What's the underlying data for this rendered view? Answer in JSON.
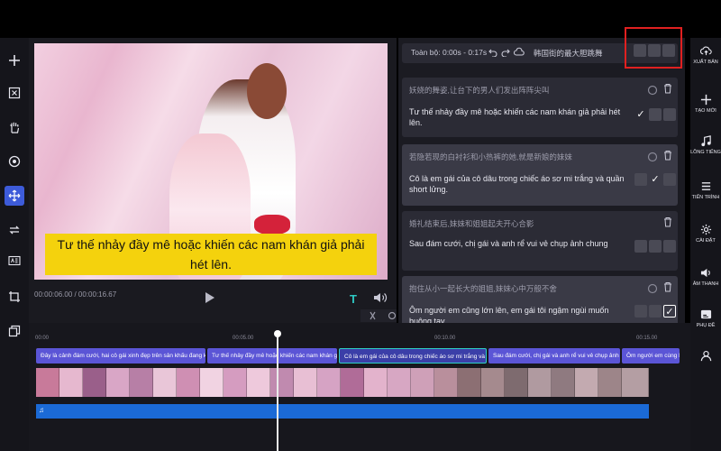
{
  "preview": {
    "caption": "Tư thế nhảy đầy mê hoặc khiến các nam khán giả phải hét lên.",
    "timecode": "00:00:06.00 / 00:00:16.67"
  },
  "panel": {
    "range_label": "Toàn bộ: 0:00s - 0:17s",
    "title": "韩国街的最大胆跳舞",
    "cards": [
      {
        "cn": "妖娆的舞姿,让台下的男人们发出阵阵尖叫",
        "vi": "Tư thế nhảy đầy mê hoặc khiến các nam khán giả phải hét lên."
      },
      {
        "cn": "若隐若现的白衬衫和小热裤的她,就是新娘的妹妹",
        "vi": "Cô là em gái của cô dâu trong chiếc áo sơ mi trắng và quần short lửng."
      },
      {
        "cn": "婚礼结束后,妹妹和姐姐起夫开心合影",
        "vi": "Sau đám cưới, chị gái và anh rể vui vẻ chụp ảnh chung"
      },
      {
        "cn": "抱住从小一起长大的姐姐,妹妹心中万般不舍",
        "vi": "Ôm người em cũng lớn lên, em gái tôi ngậm ngùi muốn buông tay"
      }
    ]
  },
  "right_rail": {
    "export": "XUẤT BẢN",
    "new": "TẠO MỚI",
    "voice": "LỒNG TIẾNG",
    "progress": "TIẾN TRÌNH",
    "settings": "CÀI ĐẶT",
    "audio": "ÂM THANH",
    "subtitle": "PHỤ ĐỀ"
  },
  "timeline": {
    "ticks": [
      "00:00",
      "00:05.00",
      "00:10.00",
      "00:15.00"
    ],
    "clips": [
      "Đây là cảnh đám cưới, hai cô gái xinh đẹp trên sân khấu đang k",
      "Tư thế nhảy đầy mê hoặc khiến các nam khán giả",
      "Cô là em gái của cô dâu trong chiếc áo sơ mi trắng và q",
      "Sau đám cưới, chị gái và anh rể vui vẻ chụp ảnh",
      "Ôm người em cùng lớn"
    ]
  },
  "colors": {
    "accent": "#3d5bd9",
    "caption_bg": "#f4d20d",
    "clip": "#5b55d6",
    "audio": "#1b6ad6",
    "highlight": "#e02020"
  }
}
